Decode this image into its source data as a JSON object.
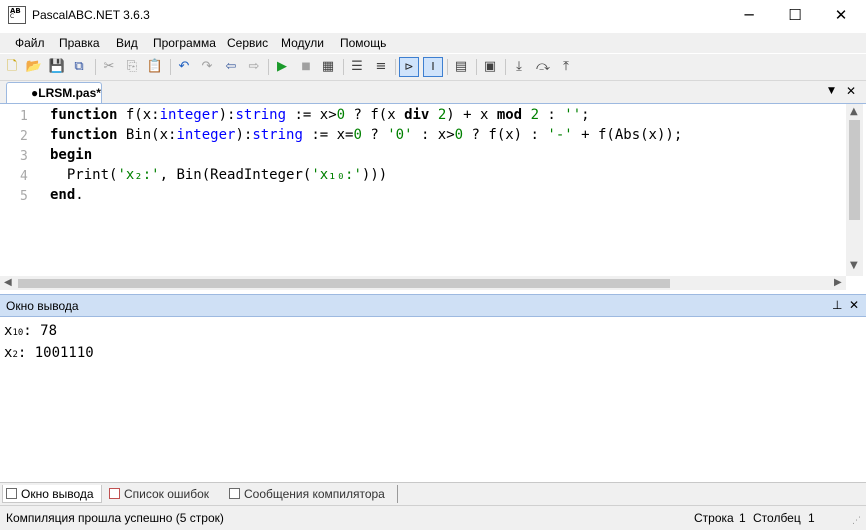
{
  "window": {
    "title": "PascalABC.NET 3.6.3",
    "icon_letters": "AB\nC\nabc",
    "minimize": "─",
    "maximize": "☐",
    "close": "✕"
  },
  "menu": [
    "Файл",
    "Правка",
    "Вид",
    "Программа",
    "Сервис",
    "Модули",
    "Помощь"
  ],
  "toolbar": {
    "icons": [
      "new-file-icon",
      "open-icon",
      "save-icon",
      "save-all-icon",
      "cut-icon",
      "copy-icon",
      "paste-icon",
      "undo-icon",
      "redo-icon",
      "navigate-back-icon",
      "navigate-forward-icon",
      "run-icon",
      "stop-icon",
      "compile-icon",
      "comment-icon",
      "format-icon",
      "output-window-icon",
      "immediate-window-icon",
      "debug-window-icon",
      "form-designer-icon",
      "step-into-icon",
      "step-over-icon",
      "step-out-icon"
    ]
  },
  "tab": {
    "label": "●LRSM.pas*",
    "dropdown": "▼",
    "close": "✕"
  },
  "editor": {
    "line_numbers": [
      "1",
      "2",
      "3",
      "4",
      "5"
    ],
    "lines": [
      [
        {
          "t": "function",
          "c": "kw"
        },
        {
          "t": " f(x:"
        },
        {
          "t": "integer",
          "c": "ty"
        },
        {
          "t": "):"
        },
        {
          "t": "string",
          "c": "ty"
        },
        {
          "t": " := x>"
        },
        {
          "t": "0",
          "c": "num"
        },
        {
          "t": " ? f(x "
        },
        {
          "t": "div",
          "c": "kw"
        },
        {
          "t": " "
        },
        {
          "t": "2",
          "c": "num"
        },
        {
          "t": ") + x "
        },
        {
          "t": "mod",
          "c": "kw"
        },
        {
          "t": " "
        },
        {
          "t": "2",
          "c": "num"
        },
        {
          "t": " : "
        },
        {
          "t": "''",
          "c": "str"
        },
        {
          "t": ";"
        }
      ],
      [
        {
          "t": "function",
          "c": "kw"
        },
        {
          "t": " Bin(x:"
        },
        {
          "t": "integer",
          "c": "ty"
        },
        {
          "t": "):"
        },
        {
          "t": "string",
          "c": "ty"
        },
        {
          "t": " := x="
        },
        {
          "t": "0",
          "c": "num"
        },
        {
          "t": " ? "
        },
        {
          "t": "'0'",
          "c": "str"
        },
        {
          "t": " : x>"
        },
        {
          "t": "0",
          "c": "num"
        },
        {
          "t": " ? f(x) : "
        },
        {
          "t": "'-'",
          "c": "str"
        },
        {
          "t": " + f(Abs(x));"
        }
      ],
      [
        {
          "t": "begin",
          "c": "kw"
        }
      ],
      [
        {
          "t": "  Print("
        },
        {
          "t": "'x₂:'",
          "c": "str"
        },
        {
          "t": ", Bin(ReadInteger("
        },
        {
          "t": "'x₁₀:'",
          "c": "str"
        },
        {
          "t": ")))"
        }
      ],
      [
        {
          "t": "end",
          "c": "kw"
        },
        {
          "t": "."
        }
      ]
    ]
  },
  "output": {
    "title": "Окно вывода",
    "pin": "⊥",
    "close": "✕",
    "lines": [
      {
        "var": "x",
        "sub": "10",
        "rest": ": 78"
      },
      {
        "var": "x",
        "sub": "2",
        "rest": ": 1001110"
      }
    ]
  },
  "bottom_tabs": [
    {
      "label": "Окно вывода",
      "active": true
    },
    {
      "label": "Список ошибок",
      "active": false
    },
    {
      "label": "Сообщения компилятора",
      "active": false
    }
  ],
  "status": {
    "message": "Компиляция прошла успешно (5 строк)",
    "row_label": "Строка",
    "row_value": "1",
    "col_label": "Столбец",
    "col_value": "1"
  }
}
